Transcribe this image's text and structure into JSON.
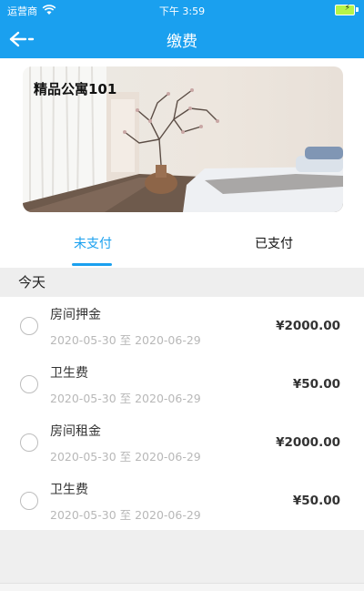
{
  "status_bar": {
    "carrier": "运营商",
    "time": "下午 3:59"
  },
  "header": {
    "title": "缴费"
  },
  "property": {
    "name": "精品公寓101"
  },
  "tabs": [
    {
      "label": "未支付",
      "active": true
    },
    {
      "label": "已支付",
      "active": false
    }
  ],
  "section": {
    "label": "今天"
  },
  "items": [
    {
      "name": "房间押金",
      "dates": "2020-05-30 至 2020-06-29",
      "amount": "¥2000.00"
    },
    {
      "name": "卫生费",
      "dates": "2020-05-30 至 2020-06-29",
      "amount": "¥50.00"
    },
    {
      "name": "房间租金",
      "dates": "2020-05-30 至 2020-06-29",
      "amount": "¥2000.00"
    },
    {
      "name": "卫生费",
      "dates": "2020-05-30 至 2020-06-29",
      "amount": "¥50.00"
    }
  ],
  "colors": {
    "accent": "#1aa0ef",
    "date_text": "#b8b8b8"
  }
}
